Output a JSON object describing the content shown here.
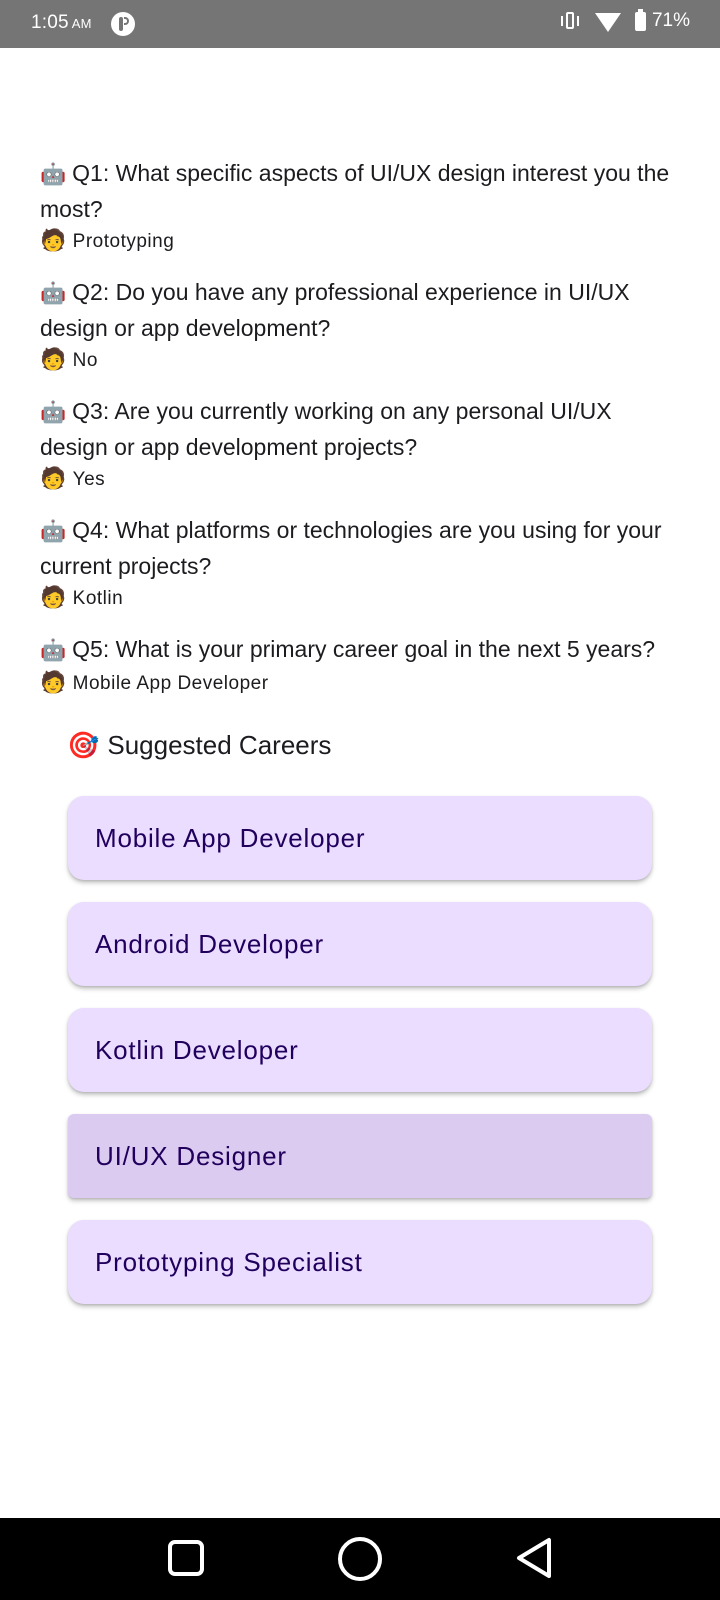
{
  "status_bar": {
    "time": "1:05",
    "ampm": "AM",
    "battery": "71%",
    "icons": [
      "app-icon",
      "vibrate-icon",
      "wifi-icon",
      "battery-icon"
    ]
  },
  "qa": [
    {
      "bot_emoji": "🤖",
      "question": "Q1: What specific aspects of UI/UX design interest you the most?",
      "user_emoji": "🧑",
      "answer": "Prototyping"
    },
    {
      "bot_emoji": "🤖",
      "question": "Q2: Do you have any professional experience in UI/UX design or app development?",
      "user_emoji": "🧑",
      "answer": "No"
    },
    {
      "bot_emoji": "🤖",
      "question": "Q3: Are you currently working on any personal UI/UX design or app development projects?",
      "user_emoji": "🧑",
      "answer": "Yes"
    },
    {
      "bot_emoji": "🤖",
      "question": "Q4: What platforms or technologies are you using for your current projects?",
      "user_emoji": "🧑",
      "answer": "Kotlin"
    },
    {
      "bot_emoji": "🤖",
      "question": "Q5: What is your primary career goal in the next 5 years?",
      "user_emoji": "🧑",
      "answer": "Mobile App Developer"
    }
  ],
  "suggestions": {
    "emoji": "🎯",
    "title": "Suggested Careers",
    "careers": [
      {
        "label": "Mobile App Developer"
      },
      {
        "label": "Android Developer"
      },
      {
        "label": "Kotlin Developer"
      },
      {
        "label": "UI/UX Designer"
      },
      {
        "label": "Prototyping Specialist"
      }
    ]
  },
  "colors": {
    "card_bg": "#eaddff",
    "card_pressed_bg": "#dccbf0",
    "card_text": "#21005d",
    "status_bar_bg": "#757575",
    "nav_bar_bg": "#000000"
  },
  "nav_bar": {
    "icons": [
      "recents-icon",
      "home-icon",
      "back-icon"
    ]
  }
}
